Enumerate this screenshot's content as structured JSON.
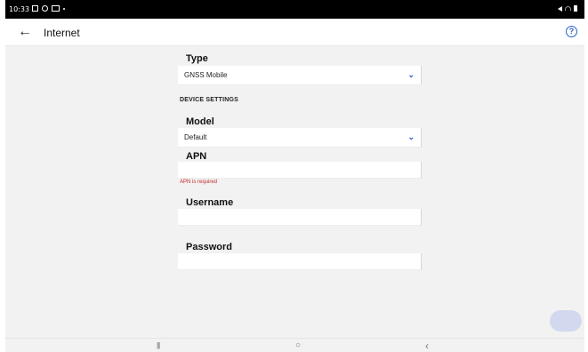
{
  "status_bar": {
    "time": "10:33"
  },
  "app_bar": {
    "title": "Internet",
    "back_glyph": "←",
    "help_glyph": "?"
  },
  "form": {
    "type": {
      "label": "Type",
      "value": "GNSS Mobile"
    },
    "section_title": "DEVICE SETTINGS",
    "model": {
      "label": "Model",
      "value": "Default"
    },
    "apn": {
      "label": "APN",
      "value": "",
      "error": "APN is required"
    },
    "username": {
      "label": "Username",
      "value": ""
    },
    "password": {
      "label": "Password",
      "value": ""
    }
  },
  "nav_bar": {
    "recents_glyph": "|||",
    "home_glyph": "○",
    "back_glyph": "‹"
  },
  "colors": {
    "accent": "#2762c9",
    "error": "#c62828",
    "background": "#f2f2f2",
    "fab": "#d2d9ef"
  }
}
